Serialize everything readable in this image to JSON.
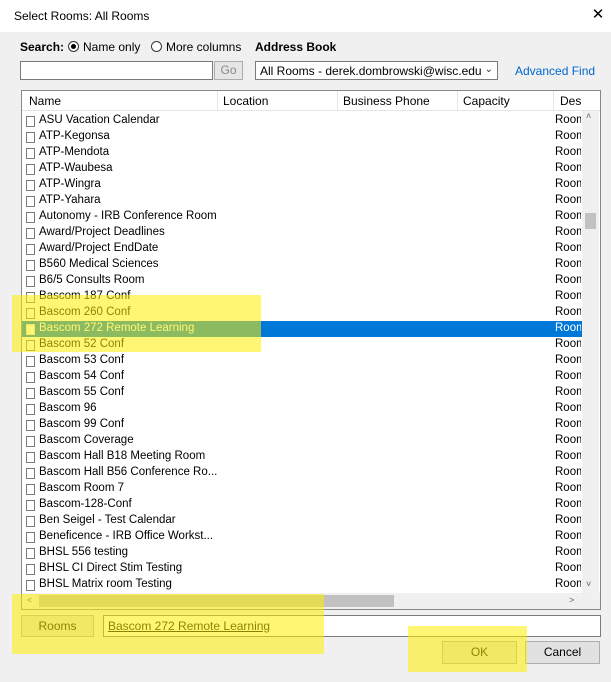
{
  "window": {
    "title": "Select Rooms: All Rooms",
    "close_glyph": "✕"
  },
  "search": {
    "label": "Search:",
    "option_name_only": "Name only",
    "option_more_columns": "More columns",
    "selected": "name_only",
    "input_value": "",
    "go_label": "Go"
  },
  "address_book": {
    "label": "Address Book",
    "value": "All Rooms - derek.dombrowski@wisc.edu",
    "advanced_find": "Advanced Find"
  },
  "table": {
    "columns": [
      "Name",
      "Location",
      "Business Phone",
      "Capacity",
      "Descrip"
    ],
    "rows": [
      {
        "name": "ASU Vacation Calendar",
        "desc": "Room"
      },
      {
        "name": "ATP-Kegonsa",
        "desc": "Room"
      },
      {
        "name": "ATP-Mendota",
        "desc": "Room"
      },
      {
        "name": "ATP-Waubesa",
        "desc": "Room"
      },
      {
        "name": "ATP-Wingra",
        "desc": "Room"
      },
      {
        "name": "ATP-Yahara",
        "desc": "Room"
      },
      {
        "name": "Autonomy - IRB Conference Room",
        "desc": "Room"
      },
      {
        "name": "Award/Project Deadlines",
        "desc": "Room"
      },
      {
        "name": "Award/Project EndDate",
        "desc": "Room"
      },
      {
        "name": "B560 Medical Sciences",
        "desc": "Room"
      },
      {
        "name": "B6/5 Consults Room",
        "desc": "Room"
      },
      {
        "name": "Bascom 187 Conf",
        "desc": "Room"
      },
      {
        "name": "Bascom 260 Conf",
        "desc": "Room"
      },
      {
        "name": "Bascom 272 Remote Learning",
        "desc": "Room",
        "selected": true
      },
      {
        "name": "Bascom 52 Conf",
        "desc": "Room"
      },
      {
        "name": "Bascom 53 Conf",
        "desc": "Room"
      },
      {
        "name": "Bascom 54 Conf",
        "desc": "Room"
      },
      {
        "name": "Bascom 55 Conf",
        "desc": "Room"
      },
      {
        "name": "Bascom 96",
        "desc": "Room"
      },
      {
        "name": "Bascom 99 Conf",
        "desc": "Room"
      },
      {
        "name": "Bascom Coverage",
        "desc": "Room"
      },
      {
        "name": "Bascom Hall B18 Meeting Room",
        "desc": "Room"
      },
      {
        "name": "Bascom Hall B56 Conference Ro...",
        "desc": "Room"
      },
      {
        "name": "Bascom Room 7",
        "desc": "Room"
      },
      {
        "name": "Bascom-128-Conf",
        "desc": "Room"
      },
      {
        "name": "Ben Seigel - Test Calendar",
        "desc": "Room"
      },
      {
        "name": "Beneficence - IRB Office Workst...",
        "desc": "Room"
      },
      {
        "name": "BHSL 556 testing",
        "desc": "Room"
      },
      {
        "name": "BHSL CI Direct Stim Testing",
        "desc": "Room"
      },
      {
        "name": "BHSL Matrix room Testing",
        "desc": "Room"
      }
    ]
  },
  "rooms": {
    "button_label": "Rooms",
    "value": "Bascom 272 Remote Learning"
  },
  "buttons": {
    "ok": "OK",
    "cancel": "Cancel"
  },
  "scroll_glyphs": {
    "up": "˄",
    "down": "˅",
    "left": "<",
    "right": ">"
  },
  "colors": {
    "selection": "#0078d7",
    "highlight": "#fff000",
    "link": "#0066cc"
  }
}
